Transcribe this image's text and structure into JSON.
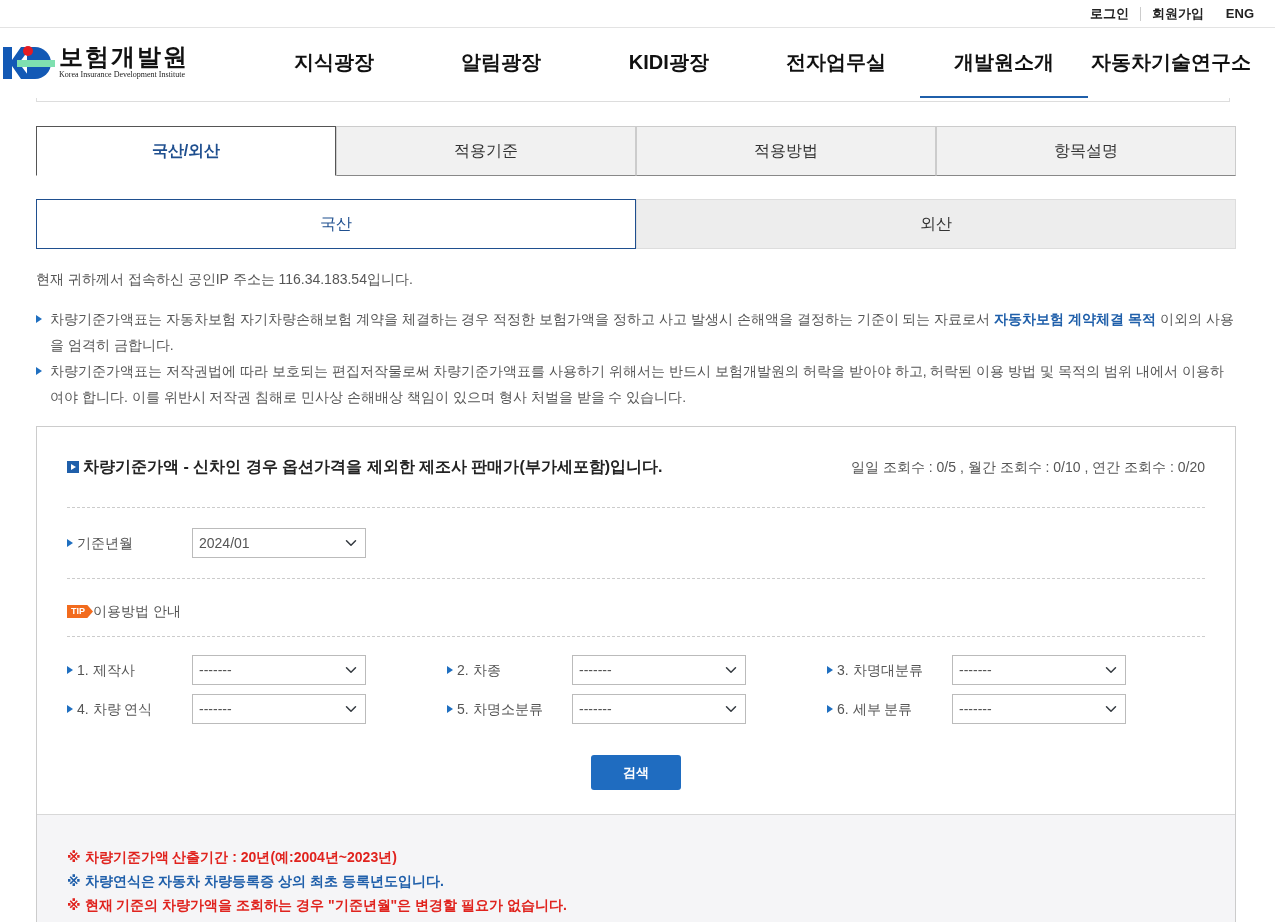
{
  "utility_links": [
    {
      "label": "로그인"
    },
    {
      "label": "회원가입"
    },
    {
      "label": "ENG"
    }
  ],
  "logo": {
    "name": "보험개발원",
    "subtitle": "Korea Insurance Development Institute"
  },
  "main_nav": [
    {
      "label": "지식광장",
      "selected": false
    },
    {
      "label": "알림광장",
      "selected": false
    },
    {
      "label": "KIDI광장",
      "selected": false
    },
    {
      "label": "전자업무실",
      "selected": false
    },
    {
      "label": "개발원소개",
      "selected": true
    },
    {
      "label": "자동차기술연구소",
      "selected": false
    }
  ],
  "tabs": [
    {
      "label": "국산/외산",
      "selected": true
    },
    {
      "label": "적용기준",
      "selected": false
    },
    {
      "label": "적용방법",
      "selected": false
    },
    {
      "label": "항목설명",
      "selected": false
    }
  ],
  "sub_tabs": [
    {
      "label": "국산",
      "selected": true
    },
    {
      "label": "외산",
      "selected": false
    }
  ],
  "ip_notice": "현재 귀하께서 접속하신 공인IP 주소는 116.34.183.54입니다.",
  "notices": [
    {
      "segments": [
        {
          "text": "차량기준가액표는 자동차보험 자기차량손해보험 계약을 체결하는 경우 적정한 보험가액을 정하고 사고 발생시 손해액을 결정하는 기준이 되는 자료로서 ",
          "highlight": false
        },
        {
          "text": "자동차보험 계약체결 목적",
          "highlight": true
        },
        {
          "text": " 이외의 사용을 엄격히 금합니다.",
          "highlight": false
        }
      ]
    },
    {
      "segments": [
        {
          "text": "차량기준가액표는 저작권법에 따라 보호되는 편집저작물로써 차량기준가액표를 사용하기 위해서는 반드시 보험개발원의 허락을 받아야 하고, 허락된 이용 방법 및 목적의 범위 내에서 이용하여야 합니다. 이를 위반시 저작권 침해로 민사상 손해배상 책임이 있으며 형사 처벌을 받을 수 있습니다.",
          "highlight": false
        }
      ]
    }
  ],
  "panel": {
    "title": "차량기준가액 - 신차인 경우 옵션가격을 제외한 제조사 판매가(부가세포함)입니다.",
    "query_counts": "일일 조회수 : 0/5 , 월간 조회수 : 0/10 , 연간 조회수 : 0/20",
    "base_month": {
      "label": "기준년월",
      "value": "2024/01"
    },
    "tip_badge": "TIP",
    "tip_label": "이용방법 안내",
    "filters": [
      {
        "label": "1. 제작사",
        "value": "-------"
      },
      {
        "label": "2. 차종",
        "value": "-------"
      },
      {
        "label": "3. 차명대분류",
        "value": "-------"
      },
      {
        "label": "4. 차량 연식",
        "value": "-------"
      },
      {
        "label": "5. 차명소분류",
        "value": "-------"
      },
      {
        "label": "6. 세부 분류",
        "value": "-------"
      }
    ],
    "search_button": "검색"
  },
  "footnotes": [
    {
      "text": "※ 차량기준가액 산출기간 : 20년(예:2004년~2023년)",
      "color": "#e0231e"
    },
    {
      "text": "※ 차량연식은 자동차 차량등록증 상의 최초 등록년도입니다.",
      "color": "#1f5faa"
    },
    {
      "text": "※ 현재 기준의 차량가액을 조회하는 경우 \"기준년월\"은 변경할 필요가 없습니다.",
      "color": "#e0231e"
    }
  ]
}
